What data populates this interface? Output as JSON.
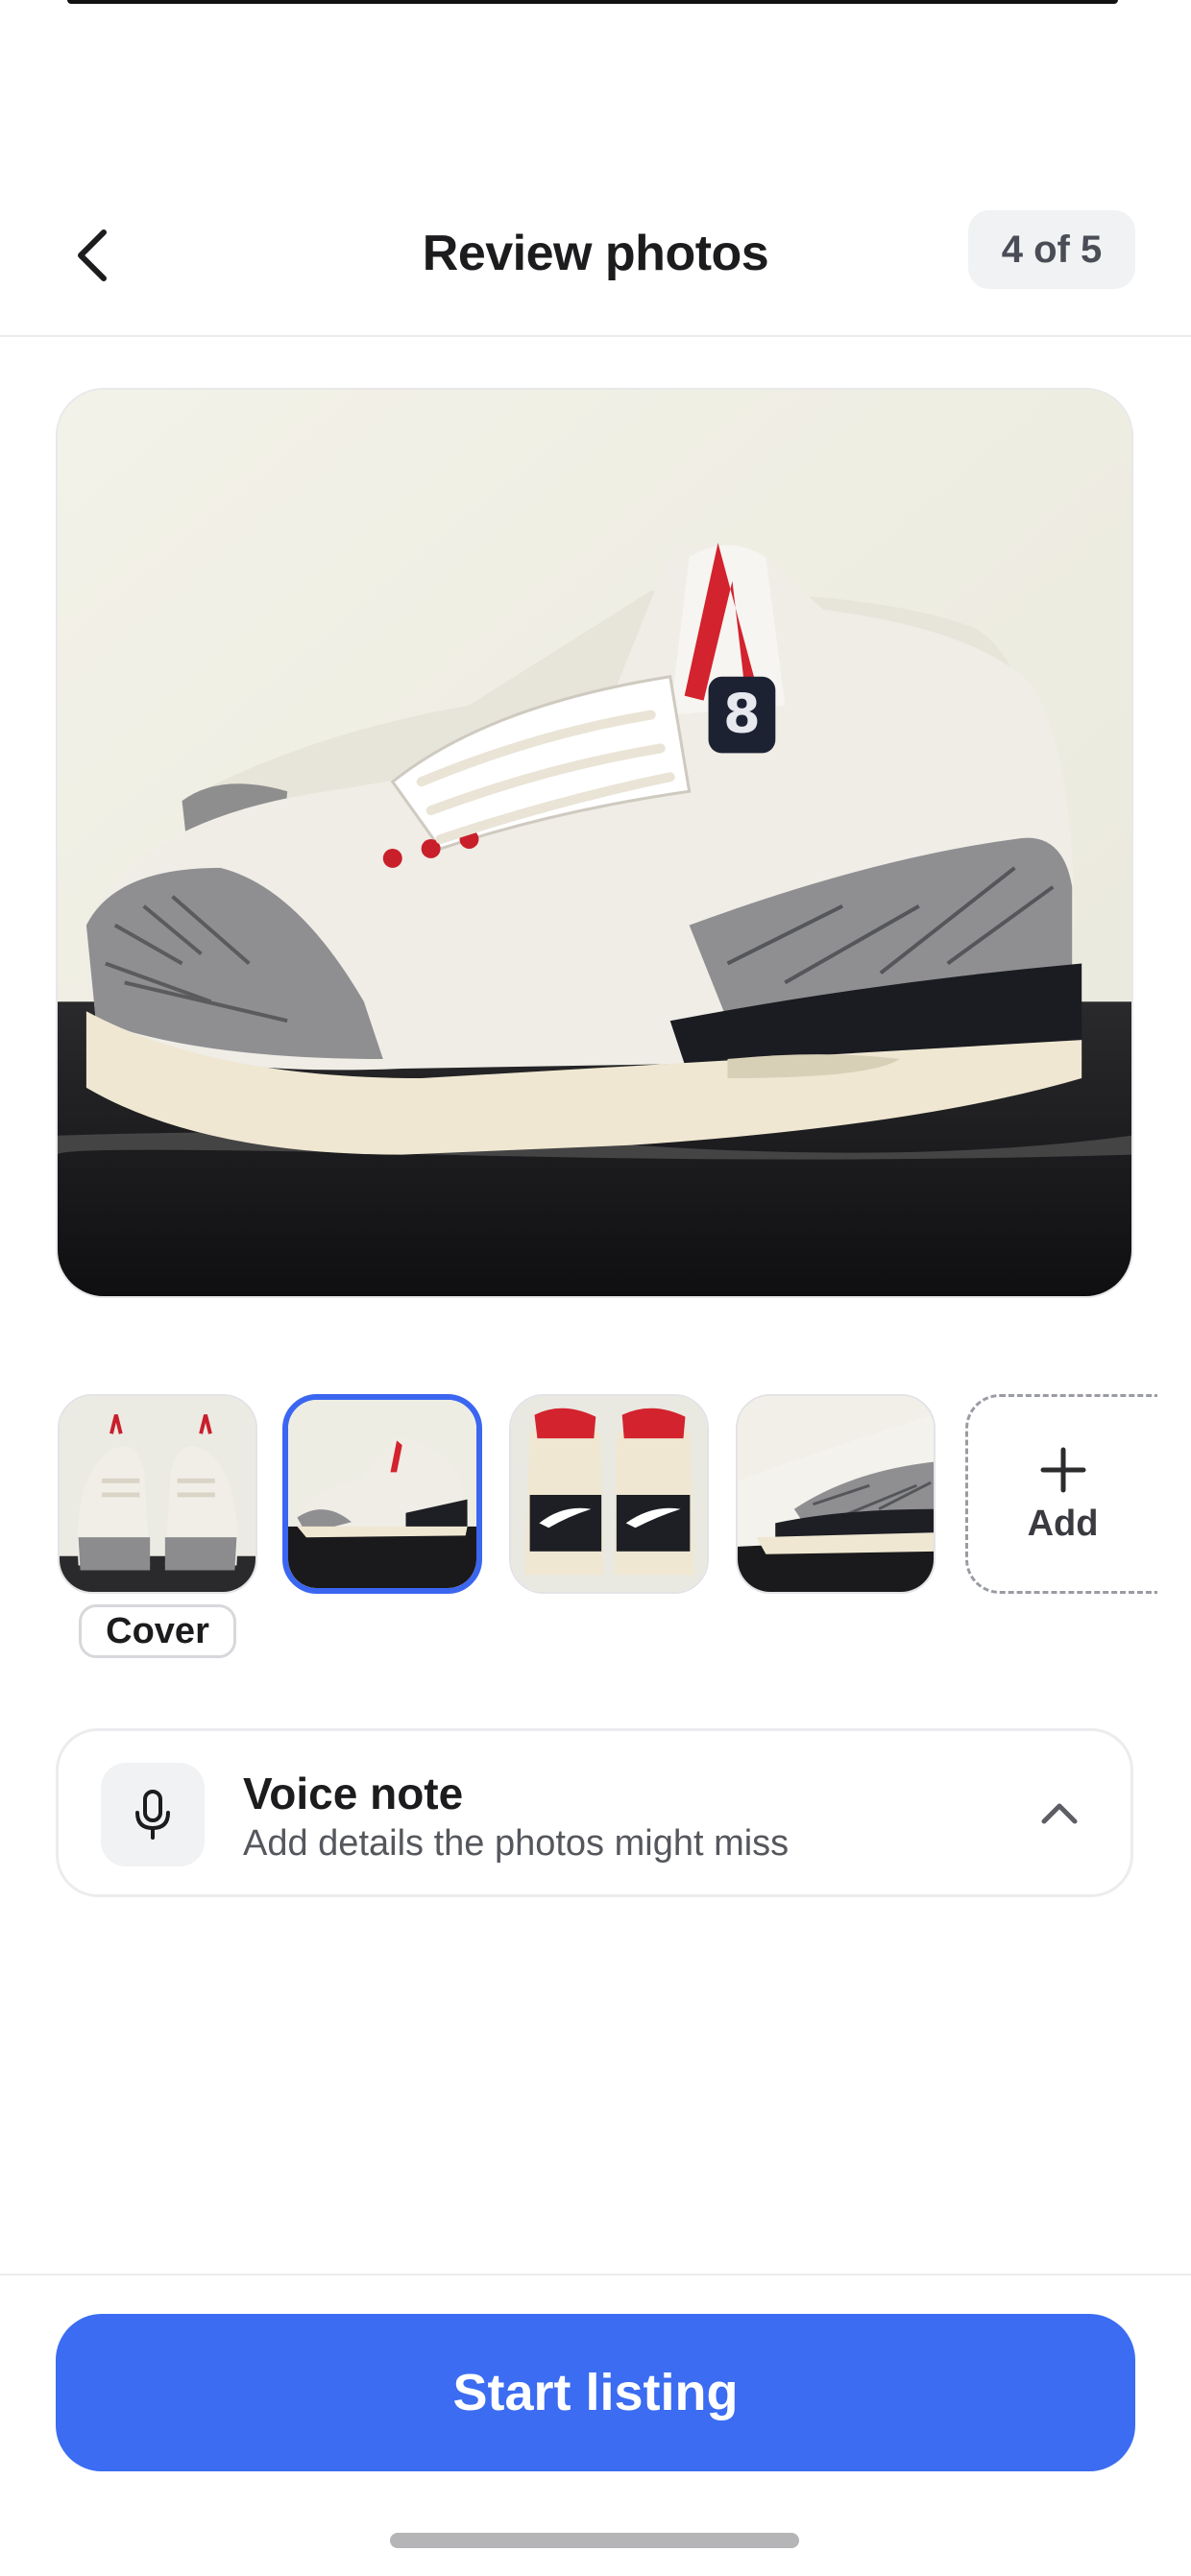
{
  "header": {
    "title": "Review photos",
    "counter": "4 of 5",
    "back_icon": "chevron-left-icon"
  },
  "photos": {
    "selected_index": 1,
    "thumbnails": [
      {
        "name": "front-view",
        "is_cover": true
      },
      {
        "name": "side-view",
        "is_cover": false
      },
      {
        "name": "heel-view",
        "is_cover": false
      },
      {
        "name": "detail-view",
        "is_cover": false
      }
    ],
    "cover_label": "Cover",
    "add_label": "Add"
  },
  "voice_note": {
    "title": "Voice note",
    "subtitle": "Add details the photos might miss",
    "icon": "microphone-icon",
    "expand_icon": "chevron-up-icon"
  },
  "footer": {
    "primary_label": "Start listing"
  },
  "colors": {
    "accent": "#3b6cf2",
    "selected_border": "#3b66f0",
    "badge_bg": "#f1f2f4"
  }
}
